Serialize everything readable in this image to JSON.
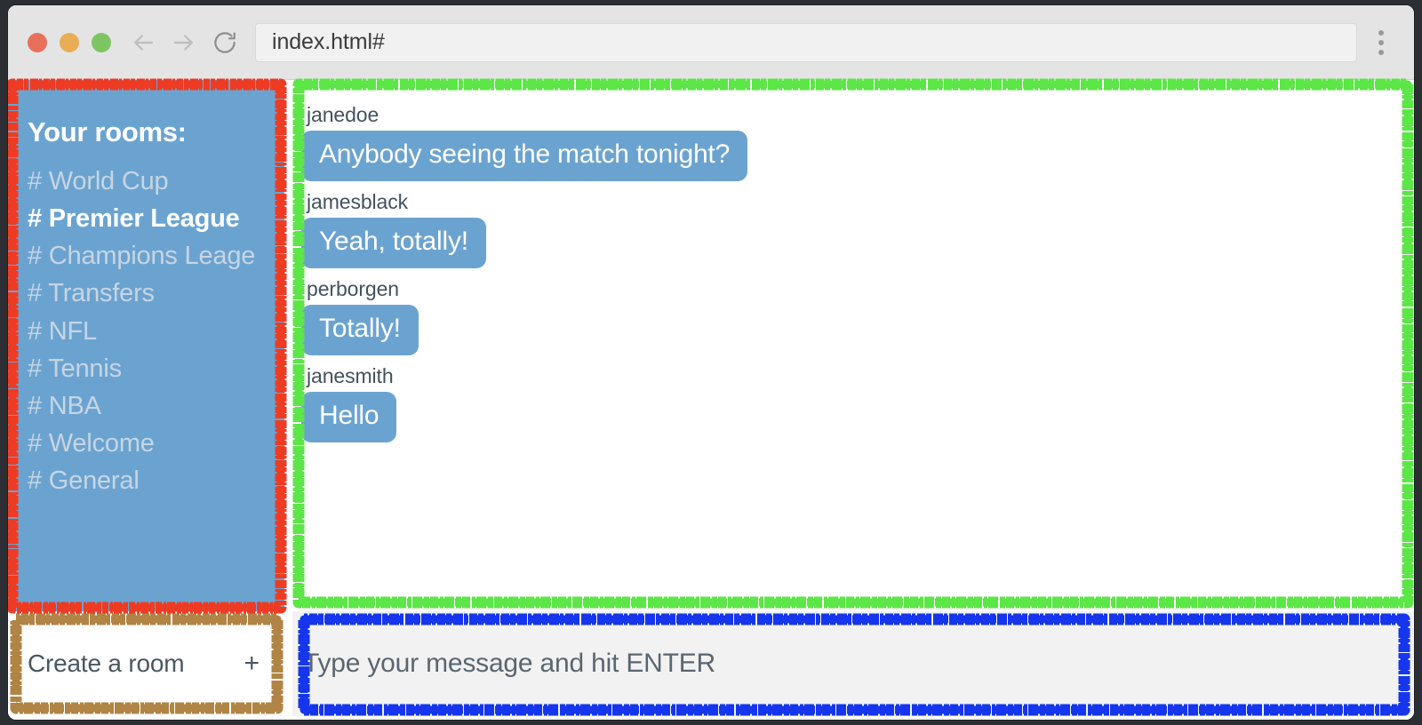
{
  "browser": {
    "url": "index.html#",
    "traffic_lights": [
      "close-button",
      "minimize-button",
      "maximize-button"
    ],
    "back_icon": "back-arrow-icon",
    "forward_icon": "forward-arrow-icon",
    "reload_icon": "reload-icon",
    "menu_icon": "kebab-menu-icon",
    "colors": {
      "toolbar_bg": "#e4e4e4",
      "close": "#e8705a",
      "minimize": "#e9ad55",
      "maximize": "#7dc563"
    }
  },
  "sidebar": {
    "title": "Your rooms:",
    "active_room": "# Premier League",
    "rooms": [
      {
        "label": "# World Cup",
        "active": false
      },
      {
        "label": "# Premier League",
        "active": true
      },
      {
        "label": "# Champions Leage",
        "active": false
      },
      {
        "label": "# Transfers",
        "active": false
      },
      {
        "label": "# NFL",
        "active": false
      },
      {
        "label": "# Tennis",
        "active": false
      },
      {
        "label": "# NBA",
        "active": false
      },
      {
        "label": "# Welcome",
        "active": false
      },
      {
        "label": "# General",
        "active": false
      }
    ],
    "bg_color": "#6ba3d0",
    "inactive_color": "#c6d5e3",
    "active_color": "#ffffff"
  },
  "create_room": {
    "label": "Create a room",
    "plus": "+"
  },
  "chat": {
    "messages": [
      {
        "user": "janedoe",
        "text": "Anybody seeing the match tonight?"
      },
      {
        "user": "jamesblack",
        "text": "Yeah, totally!"
      },
      {
        "user": "perborgen",
        "text": "Totally!"
      },
      {
        "user": "janesmith",
        "text": "Hello"
      }
    ],
    "bubble_color": "#6ba3d0",
    "username_color": "#44525e"
  },
  "composer": {
    "value": "",
    "placeholder": "Type your message and hit ENTER"
  },
  "annotations": [
    {
      "name": "sidebar-highlight",
      "color": "#ee3b24"
    },
    {
      "name": "chat-highlight",
      "color": "#5ce647"
    },
    {
      "name": "create-room-highlight",
      "color": "#b08445"
    },
    {
      "name": "composer-highlight",
      "color": "#1536ec"
    }
  ]
}
